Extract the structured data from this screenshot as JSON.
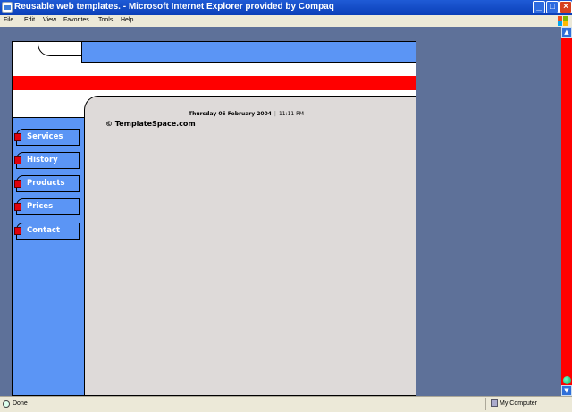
{
  "window": {
    "title": "Reusable web templates. - Microsoft Internet Explorer provided by Compaq",
    "minimize": "_",
    "maximize": "□",
    "close": "×"
  },
  "menu": [
    "File",
    "Edit",
    "View",
    "Favorites",
    "Tools",
    "Help"
  ],
  "page": {
    "date": "Thursday 05 February 2004",
    "separator": "|",
    "time": "11:11 PM",
    "copyright": "© TemplateSpace.com",
    "nav": [
      "Services",
      "History",
      "Products",
      "Prices",
      "Contact"
    ],
    "colors": {
      "header_blue": "#5b95f5",
      "accent_red": "#ff0000",
      "panel_gray": "#dedad9",
      "outer_bg": "#5e7199"
    }
  },
  "status": {
    "text": "Done",
    "zone": "My Computer"
  },
  "icons": [
    "ie-page-icon",
    "windows-logo-icon",
    "done-page-icon",
    "my-computer-icon",
    "scroll-up-arrow-icon",
    "scroll-down-arrow-icon"
  ]
}
